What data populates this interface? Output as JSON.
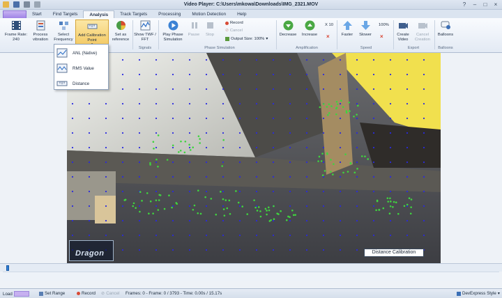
{
  "window": {
    "title": "Video Player: C:\\Users\\mkowa\\Downloads\\IMG_2321.MOV",
    "controls": [
      "?",
      "–",
      "□",
      "×"
    ]
  },
  "tabs": [
    "Start",
    "Find Targets",
    "Analysis",
    "Track Targets",
    "Processing",
    "Motion Detection",
    "Help"
  ],
  "ribbon": {
    "frame_rate": "Frame Rate: 240",
    "process_vibration": "Process vibration",
    "select_frequency": "Select Frequency",
    "add_calibration_point": "Add Calibration Point",
    "set_as_reference": "Set as reference",
    "show_twf_fft": "Show TWF / FFT",
    "signals_group": "Signals",
    "play_phase_simulation": "Play Phase Simulation",
    "pause": "Pause",
    "stop": "Stop",
    "record": "Record",
    "cancel": "Cancel",
    "output_size": "Output Size: 100%",
    "phase_simulation_group": "Phase Simulation",
    "decrease": "Decrease",
    "increase": "Increase",
    "x10": "X 10",
    "amplification_group": "Amplification",
    "faster": "Faster",
    "slower": "Slower",
    "speed_value": "100%",
    "speed_group": "Speed",
    "create_video": "Create Video",
    "cancel_creation": "Cancel Creation",
    "export_group": "Export",
    "balloons": "Balloons",
    "balloons_group": "Balloons"
  },
  "dropdown": {
    "items": [
      "ANL (Native)",
      "RMS Value",
      "Distance"
    ]
  },
  "video": {
    "calibration_label": "Distance Calibration",
    "logo_text": "Dragon"
  },
  "status": {
    "load": "Load",
    "set_range": "Set Range",
    "record": "Record",
    "cancel": "Cancel",
    "frames_info": "Frames: 0 - Frame: 0 / 3793 - Time: 0.00s / 15.17s",
    "style": "DevExpress Style",
    "progress_fraction": 0.0
  },
  "colors": {
    "accent": "#2e7ed6",
    "marker_blue": "#2a2adf",
    "marker_green": "#3fd43f",
    "yellow_beam": "#f1e04e"
  }
}
